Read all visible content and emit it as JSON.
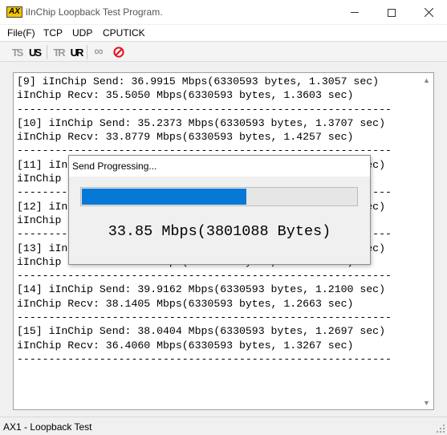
{
  "window": {
    "app_icon_text": "AX",
    "title": "iInChip Loopback Test Program."
  },
  "menu": {
    "file": "File(F)",
    "tcp": "TCP",
    "udp": "UDP",
    "cputick": "CPUTICK"
  },
  "toolbar": {
    "tcp_server": "TS",
    "udp_server": "US",
    "tcp_recv": "TR",
    "udp_recv": "UR",
    "loop_icon": "loop-icon",
    "stop_icon": "stop-icon"
  },
  "log": {
    "lines": [
      "[9] iInChip Send: 36.9915 Mbps(6330593 bytes, 1.3057 sec)",
      "iInChip Recv: 35.5050 Mbps(6330593 bytes, 1.3603 sec)",
      "-----------------------------------------------------------",
      "[10] iInChip Send: 35.2373 Mbps(6330593 bytes, 1.3707 sec)",
      "iInChip Recv: 33.8779 Mbps(6330593 bytes, 1.4257 sec)",
      "-----------------------------------------------------------",
      "[11] iInChip Send: 37.6108 Mbps(6330593 bytes, 1.2213 sec)",
      "iInChip Recv: 36.1722 Mbps(6330593 bytes, 1.2698 sec)",
      "-----------------------------------------------------------",
      "[12] iInChip Send: 38.3302 Mbps(6330593 bytes, 1.4963 sec)",
      "iInChip Recv: 35.8841 Mbps(6330593 bytes, 1.5304 sec)",
      "-----------------------------------------------------------",
      "[13] iInChip Send: 37.0451 Mbps(6330593 bytes, 1.3497 sec)",
      "iInChip Recv: 35.6620 Mbps(6330593 bytes, 1.3981 sec)",
      "-----------------------------------------------------------",
      "[14] iInChip Send: 39.9162 Mbps(6330593 bytes, 1.2100 sec)",
      "iInChip Recv: 38.1405 Mbps(6330593 bytes, 1.2663 sec)",
      "-----------------------------------------------------------",
      "[15] iInChip Send: 38.0404 Mbps(6330593 bytes, 1.2697 sec)",
      "iInChip Recv: 36.4060 Mbps(6330593 bytes, 1.3267 sec)",
      "-----------------------------------------------------------"
    ]
  },
  "dialog": {
    "title": "Send Progressing...",
    "progress_fraction": 0.6,
    "status": "33.85 Mbps(3801088 Bytes)"
  },
  "statusbar": {
    "text": "AX1 - Loopback Test"
  },
  "colors": {
    "progress_fill": "#0679d6",
    "app_icon_bg": "#f5c400",
    "stop_icon": "#e0141e"
  }
}
